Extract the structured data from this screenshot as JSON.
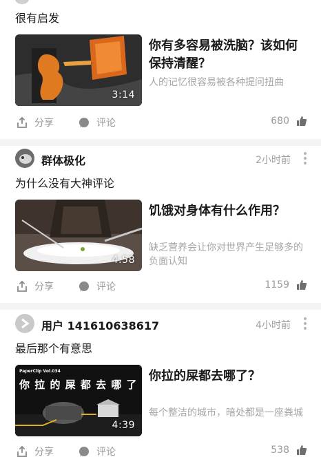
{
  "posts": [
    {
      "comment": "很有启发",
      "video": {
        "title": "你有多容易被洗脑？该如何保持清醒？",
        "description": "人的记忆很容易被各种提问扭曲",
        "duration": "3:14"
      },
      "actions": {
        "share": "分享",
        "comment": "评论",
        "likes": "680"
      }
    },
    {
      "user": {
        "name": "群体极化",
        "time": "2小时前"
      },
      "comment": "为什么没有大神评论",
      "video": {
        "title": "饥饿对身体有什么作用？",
        "description": "缺乏营养会让你对世界产生足够多的负面认知",
        "duration": "4:58"
      },
      "actions": {
        "share": "分享",
        "comment": "评论",
        "likes": "1159"
      }
    },
    {
      "user": {
        "name": "用户 141610638617",
        "time": "4小时前"
      },
      "comment": "最后那个有意思",
      "video": {
        "title": "你拉的屎都去哪了？",
        "description": "每个整洁的城市，暗处都是一座粪城",
        "duration": "4:39",
        "thumb_caption": "你 拉 的 屎 都 去 哪 了",
        "thumb_badge": "PaperClip Vol.034"
      },
      "actions": {
        "share": "分享",
        "comment": "评论",
        "likes": "538"
      }
    }
  ],
  "icons": {
    "share": "share-icon",
    "comment": "comment-bubble-icon",
    "like": "thumbs-up-icon",
    "more": "more-vertical-icon"
  },
  "colors": {
    "meta_gray": "#9a9a9a",
    "divider": "#f4f4f4",
    "title": "#1a1a1a"
  }
}
